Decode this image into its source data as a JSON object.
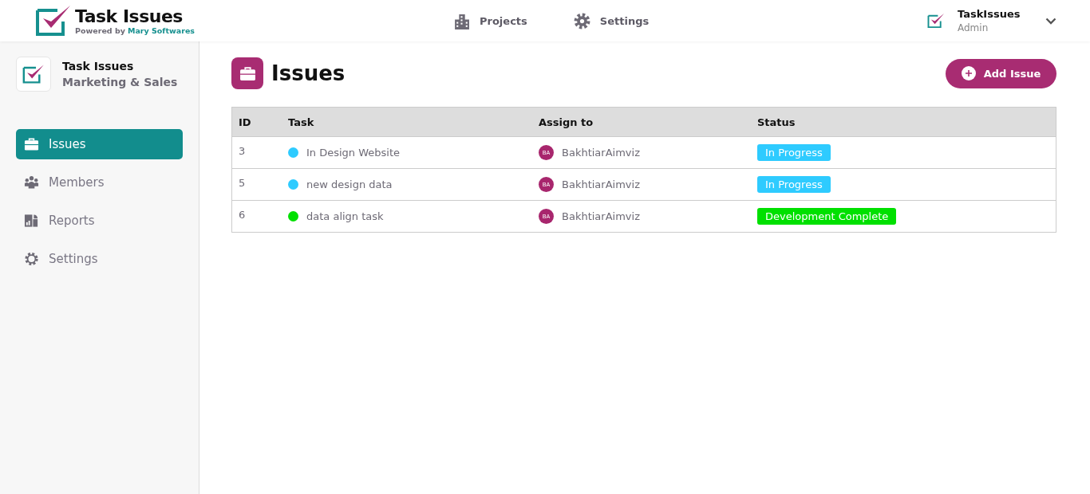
{
  "header": {
    "brand": "Task Issues",
    "powered_by": "Powered by",
    "company": "Mary Softwares",
    "nav": [
      {
        "label": "Projects"
      },
      {
        "label": "Settings"
      }
    ],
    "user": {
      "name": "TaskIssues",
      "role": "Admin"
    }
  },
  "sidebar": {
    "title": "Task Issues",
    "subtitle": "Marketing & Sales",
    "items": [
      {
        "label": "Issues",
        "selected": true
      },
      {
        "label": "Members",
        "selected": false
      },
      {
        "label": "Reports",
        "selected": false
      },
      {
        "label": "Settings",
        "selected": false
      }
    ]
  },
  "page": {
    "title": "Issues",
    "add_button": "Add Issue"
  },
  "table": {
    "columns": [
      "ID",
      "Task",
      "Assign to",
      "Status"
    ],
    "rows": [
      {
        "id": "3",
        "task": "In Design Website",
        "color": "#2ecbff",
        "initials": "BA",
        "assignee": "BakhtiarAimviz",
        "status": {
          "label": "In Progress",
          "color": "#2ecbff"
        }
      },
      {
        "id": "5",
        "task": "new design data",
        "color": "#2ecbff",
        "initials": "BA",
        "assignee": "BakhtiarAimviz",
        "status": {
          "label": "In Progress",
          "color": "#2ecbff"
        }
      },
      {
        "id": "6",
        "task": "data align task",
        "color": "#00e000",
        "initials": "BA",
        "assignee": "BakhtiarAimviz",
        "status": {
          "label": "Development Complete",
          "color": "#00e000"
        }
      }
    ]
  }
}
